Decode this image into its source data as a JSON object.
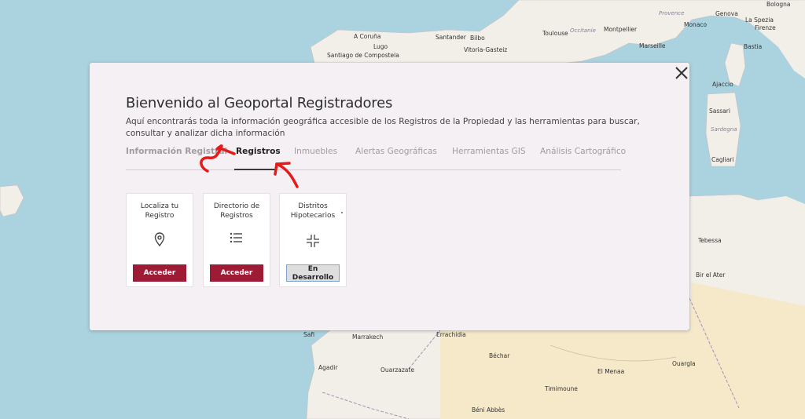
{
  "modal": {
    "title": "Bienvenido al Geoportal Registradores",
    "subtitle": "Aquí encontrarás toda la información geográfica accesible de los Registros de la Propiedad y las herramientas para buscar, consultar y analizar dicha información",
    "close_icon": "close-icon",
    "tabs": [
      {
        "label": "Información Registral",
        "active": false
      },
      {
        "label": "Registros",
        "active": true
      },
      {
        "label": "Inmuebles",
        "active": false
      },
      {
        "label": "Alertas Geográficas",
        "active": false
      },
      {
        "label": "Herramientas GIS",
        "active": false
      },
      {
        "label": "Análisis Cartográfico",
        "active": false
      }
    ],
    "cards": [
      {
        "title": "Localiza tu Registro",
        "icon": "location-pin-icon",
        "button": "Acceder"
      },
      {
        "title": "Directorio de Registros",
        "icon": "list-icon",
        "button": "Acceder"
      },
      {
        "title": "Distritos Hipotecarios",
        "icon": "crop-icon",
        "button": "En Desarrollo"
      }
    ]
  },
  "map": {
    "labels": [
      "A Coruña",
      "Santiago de Compostela",
      "Lugo",
      "Santander",
      "Bilbo",
      "Vitoria-Gasteiz",
      "Toulouse",
      "Occitanie",
      "Montpellier",
      "Marseille",
      "Monaco",
      "Genova",
      "La Spezia",
      "Firenze",
      "Bologna",
      "Ajaccio",
      "Sassari",
      "Sardegna",
      "Cagliari",
      "Tebessa",
      "Bir el Ater",
      "Béchar",
      "Ouargla",
      "Safi",
      "Marrakech",
      "Agadir",
      "Ouarzazate",
      "Errachidia",
      "Timimoune",
      "El Menaa",
      "Béni Abbès",
      "Bastia",
      "Provence"
    ]
  },
  "colors": {
    "accent": "#9d1b35",
    "sea": "#aad3df",
    "land": "#f2efe9",
    "desert": "#f5e9c9",
    "annotation": "#e51b1b"
  }
}
